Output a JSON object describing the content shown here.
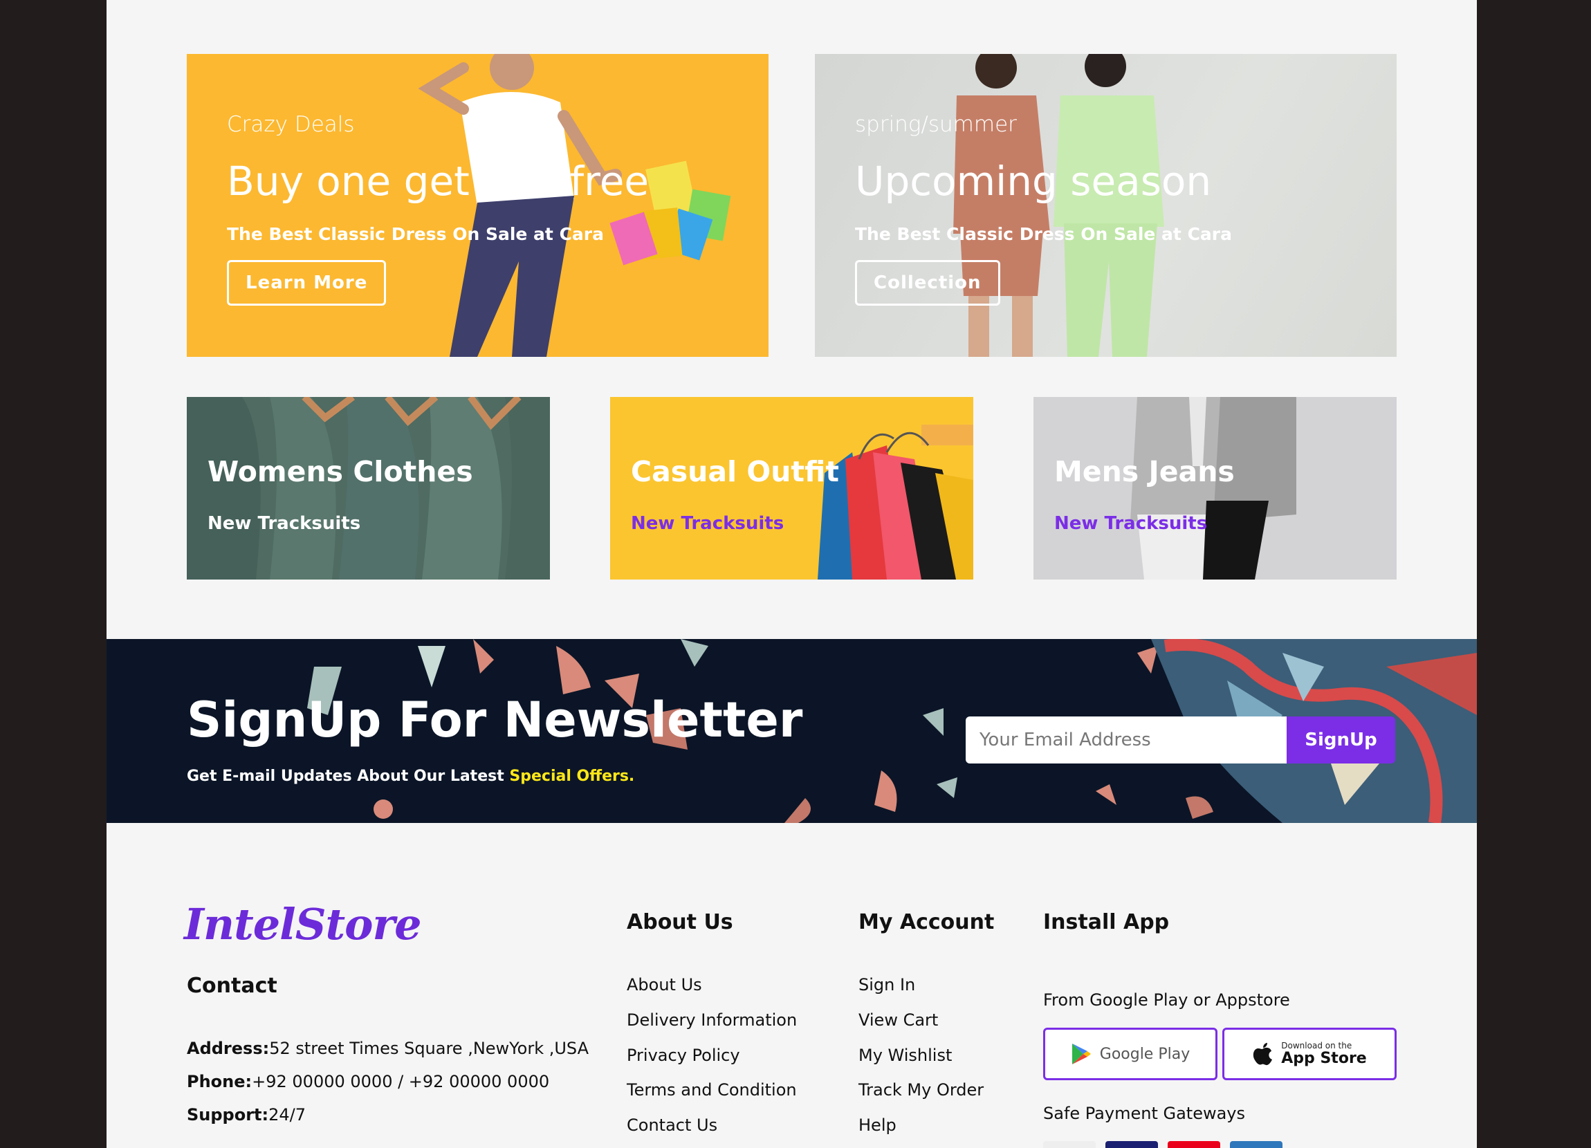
{
  "banners": [
    {
      "subtitle": "Crazy Deals",
      "title": "Buy one get one free",
      "description": "The Best Classic Dress On Sale at Cara",
      "button": "Learn More"
    },
    {
      "subtitle": "spring/summer",
      "title": "Upcoming season",
      "description": "The Best Classic Dress On Sale at Cara",
      "button": "Collection"
    }
  ],
  "small_banners": [
    {
      "title": "Womens Clothes",
      "subtitle": "New Tracksuits",
      "subtitle_color": "#ffffff"
    },
    {
      "title": "Casual Outfit",
      "subtitle": "New Tracksuits",
      "subtitle_color": "#7b2ee6"
    },
    {
      "title": "Mens Jeans",
      "subtitle": "New Tracksuits",
      "subtitle_color": "#7b2ee6"
    }
  ],
  "newsletter": {
    "title": "SignUp For Newsletter",
    "description_prefix": "Get E-mail Updates About Our Latest ",
    "description_highlight": "Special Offers.",
    "email_placeholder": "Your Email Address",
    "button": "SignUp"
  },
  "footer": {
    "logo": "IntelStore",
    "contact": {
      "heading": "Contact",
      "address_label": "Address:",
      "address": "52 street Times Square ,NewYork ,USA",
      "phone_label": "Phone:",
      "phone": "+92 00000 0000 / +92 00000 0000",
      "support_label": "Support:",
      "support": "24/7"
    },
    "about": {
      "heading": "About Us",
      "links": [
        "About Us",
        "Delivery Information",
        "Privacy Policy",
        "Terms and Condition",
        "Contact Us"
      ]
    },
    "account": {
      "heading": "My Account",
      "links": [
        "Sign In",
        "View Cart",
        "My Wishlist",
        "Track My Order",
        "Help"
      ]
    },
    "install": {
      "heading": "Install App",
      "subtitle": "From Google Play or Appstore",
      "google_play": "Google Play",
      "app_store_small": "Download on the",
      "app_store": "App Store",
      "payment_heading": "Safe Payment Gateways"
    }
  },
  "colors": {
    "accent": "#7b2ee6",
    "highlight": "#ffe817",
    "banner_yellow": "#fcb830",
    "newsletter_bg": "#0b1527"
  }
}
